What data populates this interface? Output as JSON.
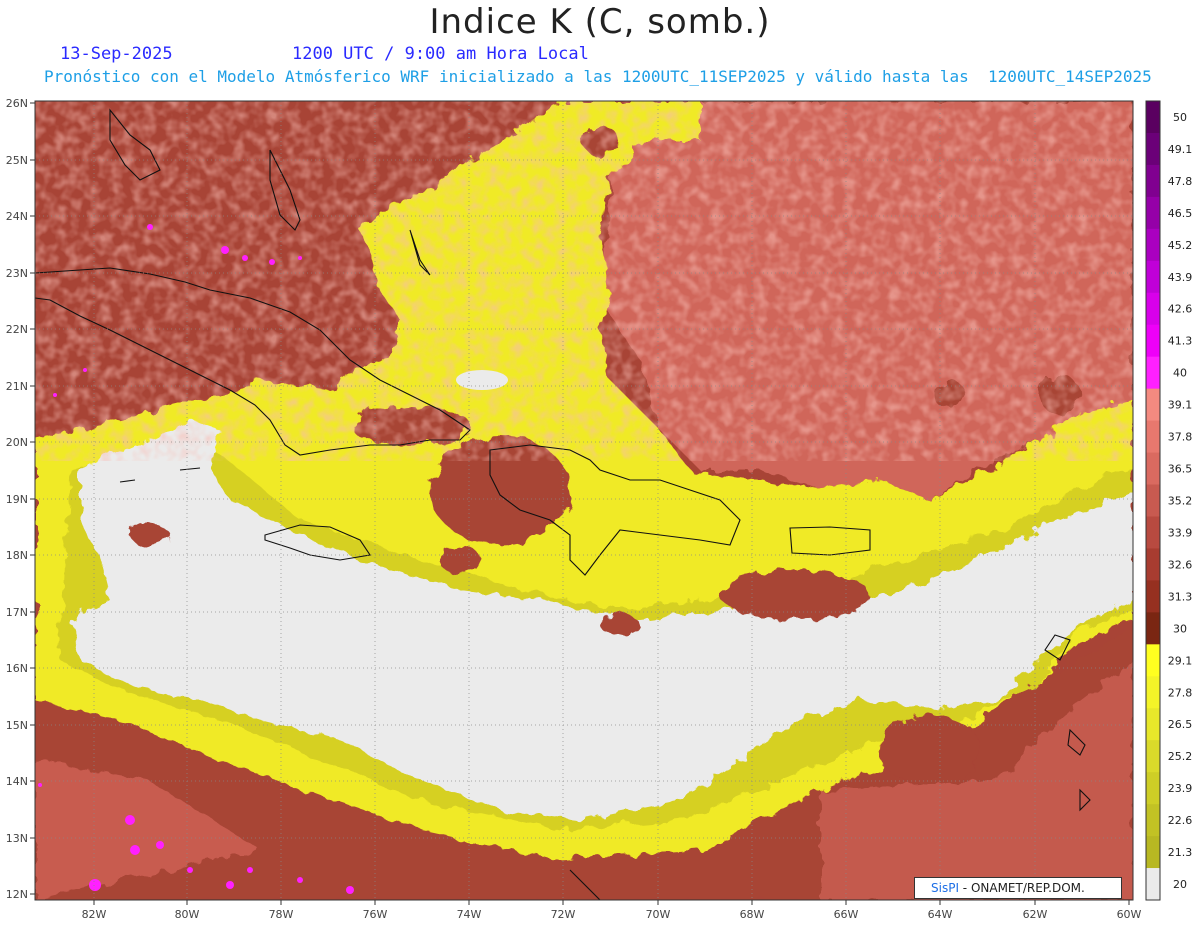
{
  "title": "Indice K (C, somb.)",
  "date": "13-Sep-2025",
  "time": "1200 UTC / 9:00 am Hora Local",
  "description": "Pronóstico con el Modelo Atmósferico WRF inicializado a las 1200UTC_11SEP2025 y válido hasta las  1200UTC_14SEP2025",
  "lat_labels": [
    "26N",
    "25N",
    "24N",
    "23N",
    "22N",
    "21N",
    "20N",
    "19N",
    "18N",
    "17N",
    "16N",
    "15N",
    "14N",
    "13N",
    "12N"
  ],
  "lon_labels": [
    "82W",
    "80W",
    "78W",
    "76W",
    "74W",
    "72W",
    "70W",
    "68W",
    "66W",
    "64W",
    "62W",
    "60W"
  ],
  "colorbar": {
    "labels": [
      "50",
      "49.1",
      "47.8",
      "46.5",
      "45.2",
      "43.9",
      "42.6",
      "41.3",
      "40",
      "39.1",
      "37.8",
      "36.5",
      "35.2",
      "33.9",
      "32.6",
      "31.3",
      "30",
      "29.1",
      "27.8",
      "26.5",
      "25.2",
      "23.9",
      "22.6",
      "21.3",
      "20"
    ],
    "colors": [
      "#5a0060",
      "#6b0078",
      "#800090",
      "#9500a8",
      "#aa00c0",
      "#c000d8",
      "#d800ea",
      "#ee00f8",
      "#ff20ff",
      "#f48a80",
      "#e8786e",
      "#da6a60",
      "#c85a50",
      "#b84a40",
      "#a83c30",
      "#963020",
      "#7a2612",
      "#ffff20",
      "#f4f428",
      "#e8e82a",
      "#dada2a",
      "#cece26",
      "#c2c224",
      "#b8b822",
      "#ebebeb"
    ]
  },
  "credit": {
    "logo": "SisPI",
    "text": " - ONAMET/REP.DOM."
  }
}
